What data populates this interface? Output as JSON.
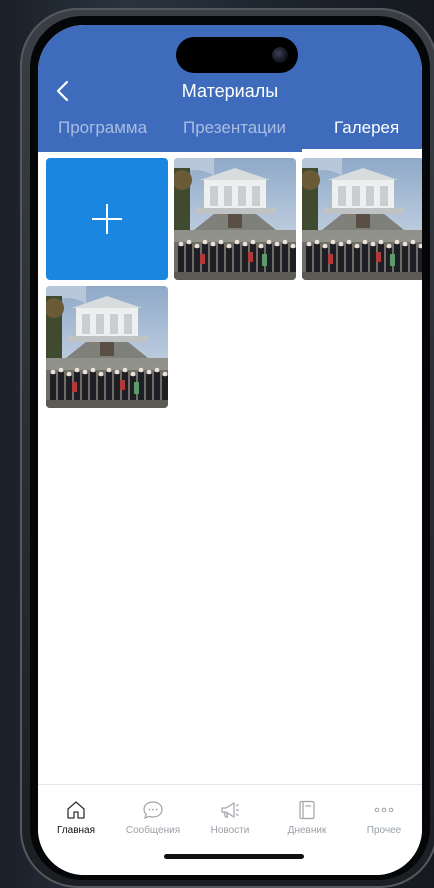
{
  "header": {
    "title": "Материалы",
    "back_icon": "chevron-left-icon",
    "background": "#3f6bbd"
  },
  "tabs": [
    {
      "label": "Программа",
      "active": false
    },
    {
      "label": "Презентации",
      "active": false
    },
    {
      "label": "Галерея",
      "active": true
    }
  ],
  "gallery": {
    "add_button_icon": "plus-icon",
    "add_button_color": "#1a86e0",
    "photos": [
      {
        "subject": "group photo on palace staircase"
      },
      {
        "subject": "group photo on palace staircase"
      },
      {
        "subject": "group photo on palace staircase"
      }
    ]
  },
  "tabbar": {
    "items": [
      {
        "label": "Главная",
        "icon": "home-icon",
        "active": true
      },
      {
        "label": "Сообщения",
        "icon": "chat-bubble-icon",
        "active": false
      },
      {
        "label": "Новости",
        "icon": "megaphone-icon",
        "active": false
      },
      {
        "label": "Дневник",
        "icon": "notebook-icon",
        "active": false
      },
      {
        "label": "Прочее",
        "icon": "more-dots-icon",
        "active": false
      }
    ]
  }
}
